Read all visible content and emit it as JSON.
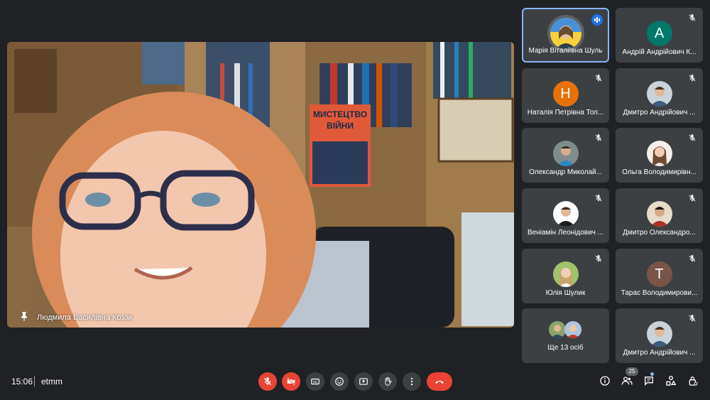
{
  "main_video": {
    "speaker_name": "Людмила Василівна Козак",
    "book_title_line1": "МИСТЕЦТВО",
    "book_title_line2": "ВІЙНИ"
  },
  "participants": [
    {
      "name": "Марія Віталіївна Шуль",
      "speaking": true,
      "muted": false,
      "avatar": "photo"
    },
    {
      "name": "Андрій Андрійович К...",
      "muted": true,
      "avatar": "letter",
      "letter": "А",
      "color": "#00796b"
    },
    {
      "name": "Наталія Петрівна Топ...",
      "muted": true,
      "avatar": "letter",
      "letter": "Н",
      "color": "#e8710a"
    },
    {
      "name": "Дмитро Андрійович ...",
      "muted": true,
      "avatar": "photo"
    },
    {
      "name": "Олександр Миколай...",
      "muted": true,
      "avatar": "photo"
    },
    {
      "name": "Ольга Володимирівн...",
      "muted": true,
      "avatar": "photo"
    },
    {
      "name": "Веніамін Леонідович ...",
      "muted": true,
      "avatar": "photo"
    },
    {
      "name": "Дмитро Олександро...",
      "muted": true,
      "avatar": "photo"
    },
    {
      "name": "Юлія Шулик",
      "muted": true,
      "avatar": "photo"
    },
    {
      "name": "Тарас Володимирови...",
      "muted": true,
      "avatar": "letter",
      "letter": "Т",
      "color": "#795548"
    },
    {
      "name": "Дмитро Андрійович ...",
      "muted": true,
      "avatar": "photo"
    }
  ],
  "more_tile": {
    "label": "Ще 13 осіб"
  },
  "bottom_bar": {
    "time": "15:06",
    "meeting_code": "etmm",
    "participant_count": "25"
  },
  "controls": [
    "mic-off-icon",
    "camera-off-icon",
    "captions-icon",
    "emoji-icon",
    "present-icon",
    "raise-hand-icon",
    "more-options-icon",
    "end-call-icon"
  ],
  "right_icons": [
    "info-icon",
    "people-icon",
    "chat-icon",
    "activities-icon",
    "host-controls-icon"
  ],
  "colors": {
    "background": "#202124",
    "tile": "#3c4043",
    "danger": "#ea4335",
    "highlight": "#8ab4f8"
  }
}
